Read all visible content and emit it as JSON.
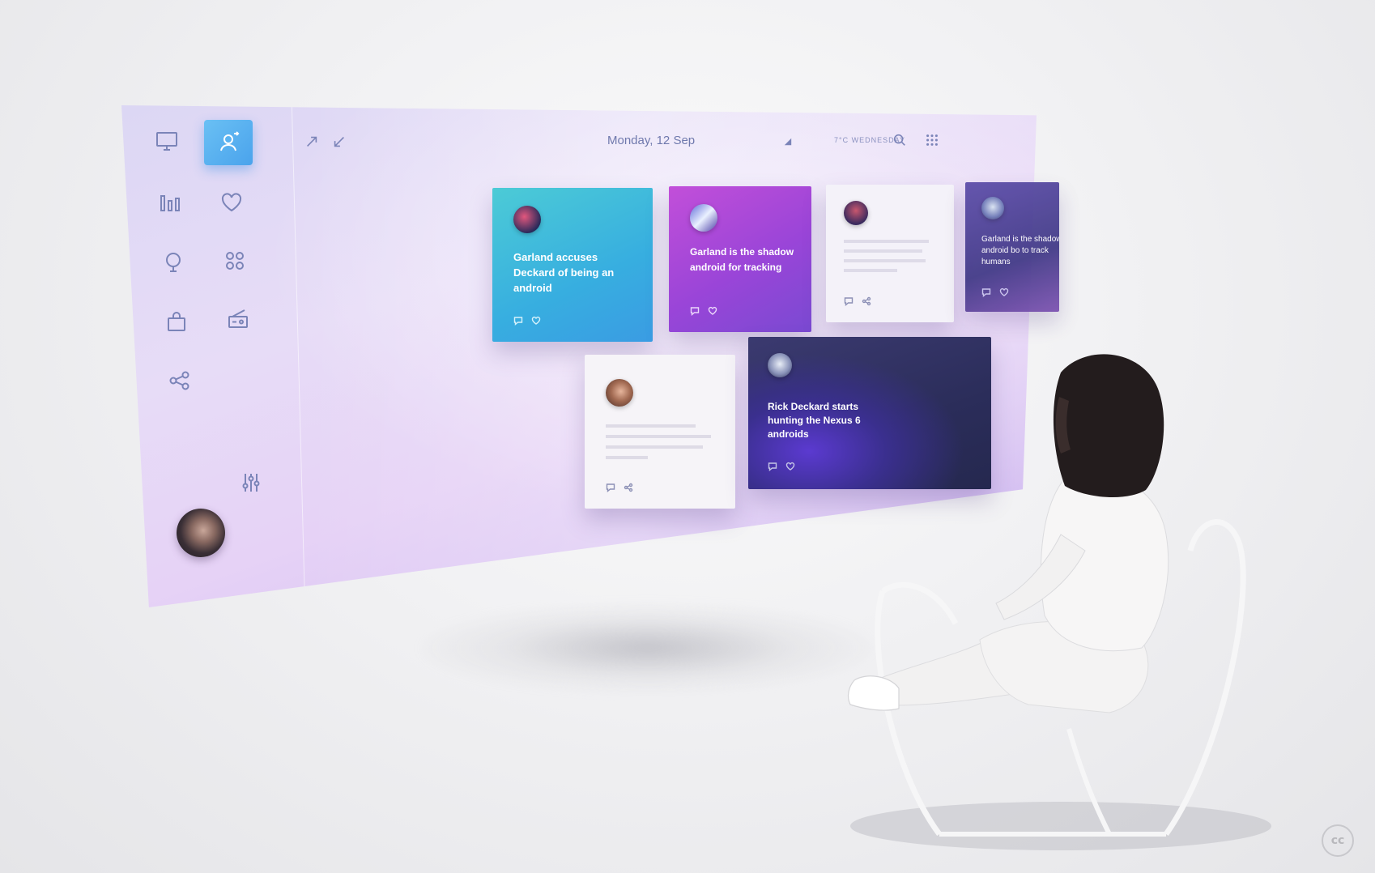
{
  "header": {
    "date": "Monday, 12 Sep",
    "weather": "7°C WEDNESDAY"
  },
  "sidebar": {
    "items": [
      {
        "icon": "monitor-icon"
      },
      {
        "icon": "user-icon",
        "active": true
      },
      {
        "icon": "bar-chart-icon"
      },
      {
        "icon": "heart-icon"
      },
      {
        "icon": "balloon-icon"
      },
      {
        "icon": "apps-grid-icon"
      },
      {
        "icon": "bag-icon"
      },
      {
        "icon": "radio-icon"
      },
      {
        "icon": "share-icon"
      },
      {
        "icon": "sliders-icon"
      }
    ]
  },
  "cards": [
    {
      "text": "Garland accuses Deckard of being an android",
      "color": "#3fb6d4"
    },
    {
      "text": "Garland is the shadow android for tracking",
      "color": "#a24ad6"
    },
    {
      "text": "",
      "color": "#f3f1f8"
    },
    {
      "text": "Garland is the shadow android bo to track humans",
      "color": "#4a3c8f"
    },
    {
      "text": "",
      "color": "#f5f3f7"
    },
    {
      "text": "Rick Deckard starts hunting the Nexus 6 androids",
      "color": "#2b2d5a"
    }
  ],
  "badge": {
    "label": "cc"
  },
  "colors": {
    "accent": "#4aa3ec",
    "panel": "#e3d8f6",
    "icon": "#7b84b8"
  }
}
